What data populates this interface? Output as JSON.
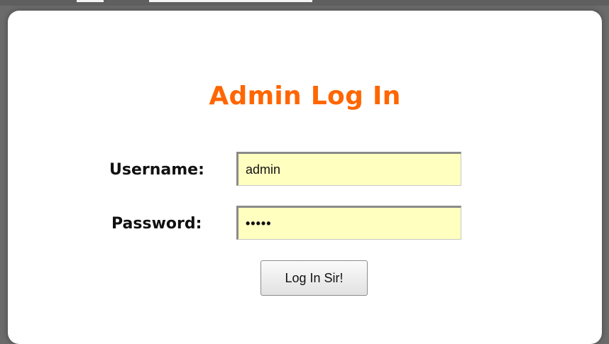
{
  "login": {
    "title": "Admin Log In",
    "username_label": "Username:",
    "username_value": "admin",
    "password_label": "Password:",
    "password_value": "•••••",
    "submit_label": "Log In Sir!"
  },
  "colors": {
    "title": "#ff6600",
    "field_bg": "#ffffc0",
    "panel_bg": "#ffffff",
    "backdrop": "#6b6b6b"
  }
}
